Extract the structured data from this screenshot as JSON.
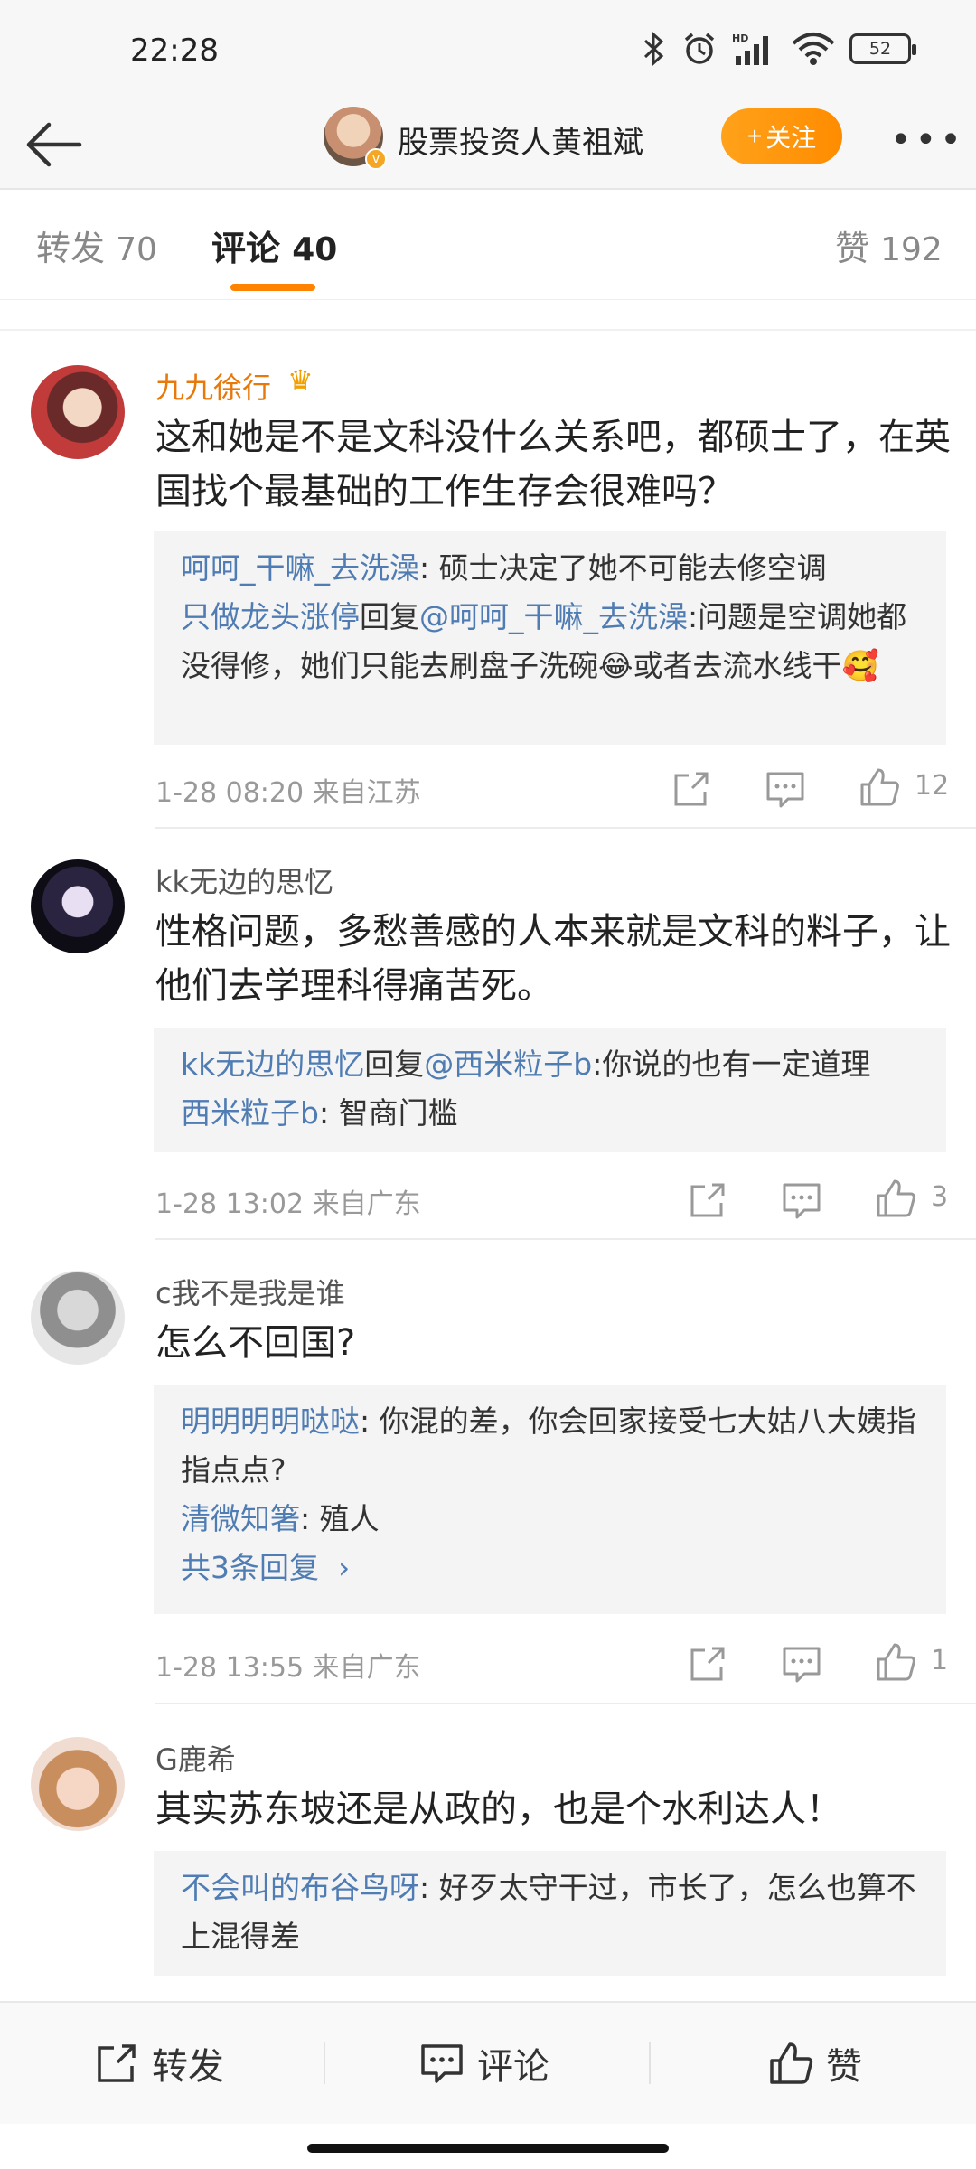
{
  "status_bar": {
    "time": "22:28",
    "battery": "52",
    "icons": [
      "bluetooth-icon",
      "alarm-icon",
      "hd-signal-icon",
      "wifi-icon",
      "battery-icon"
    ]
  },
  "header": {
    "back_icon": "back-arrow-icon",
    "title": "股票投资人黄祖斌",
    "follow_label": "关注",
    "more_icon": "more-dots-icon"
  },
  "tabs": {
    "repost": {
      "label": "转发",
      "count": "70"
    },
    "comment": {
      "label": "评论",
      "count": "40"
    },
    "like": {
      "label": "赞",
      "count": "192"
    }
  },
  "comments": [
    {
      "user": "九九徐行",
      "text": "这和她是不是文科没什么关系吧，都硕士了，在英国找个最基础的工作生存会很难吗？",
      "replies": [
        {
          "user": "呵呵_干嘛_去洗澡",
          "sep": ": ",
          "text": "硕士决定了她不可能去修空调"
        },
        {
          "user": "只做龙头涨停",
          "mid": "回复",
          "mention": "@呵呵_干嘛_去洗澡",
          "sep": ":",
          "text": "问题是空调她都没得修，她们只能去刷盘子洗碗😂或者去流水线干🥰"
        }
      ],
      "time": "1-28 08:20",
      "location": "来自江苏",
      "likes": "12"
    },
    {
      "user": "kk无边的思忆",
      "text": "性格问题，多愁善感的人本来就是文科的料子，让他们去学理科得痛苦死。",
      "replies": [
        {
          "user": "kk无边的思忆",
          "mid": "回复",
          "mention": "@西米粒子b",
          "sep": ":",
          "text": "你说的也有一定道理"
        },
        {
          "user": "西米粒子b",
          "sep": ": ",
          "text": "智商门槛"
        }
      ],
      "time": "1-28 13:02",
      "location": "来自广东",
      "likes": "3"
    },
    {
      "user": "c我不是我是谁",
      "text": "怎么不回国?",
      "replies": [
        {
          "user": "明明明明哒哒",
          "sep": ": ",
          "text": "你混的差，你会回家接受七大姑八大姨指指点点?"
        },
        {
          "user": "清微知箸",
          "sep": ": ",
          "text": "殖人"
        }
      ],
      "more_replies": "共3条回复",
      "time": "1-28 13:55",
      "location": "来自广东",
      "likes": "1"
    },
    {
      "user": "G鹿希",
      "text": "其实苏东坡还是从政的，也是个水利达人！",
      "replies": [
        {
          "user": "不会叫的布谷鸟呀",
          "sep": ": ",
          "text": "好歹太守干过，市长了，怎么也算不上混得差"
        }
      ]
    }
  ],
  "bottom_bar": {
    "repost": "转发",
    "comment": "评论",
    "like": "赞"
  }
}
